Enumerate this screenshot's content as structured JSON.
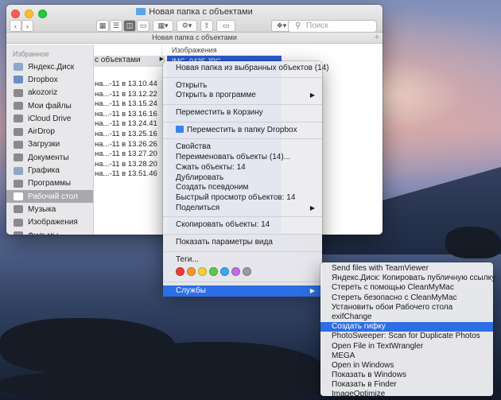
{
  "window": {
    "title": "Новая папка с объектами",
    "pathbar_title": "Новая папка с объектами",
    "search_placeholder": "Поиск"
  },
  "sidebar": {
    "section": "Избранное",
    "items": [
      {
        "label": "Яндекс.Диск",
        "icon": "folder-icon"
      },
      {
        "label": "Dropbox",
        "icon": "dropbox-icon"
      },
      {
        "label": "akozoriz",
        "icon": "home-icon"
      },
      {
        "label": "Мои файлы",
        "icon": "files-icon"
      },
      {
        "label": "iCloud Drive",
        "icon": "cloud-icon"
      },
      {
        "label": "AirDrop",
        "icon": "airdrop-icon"
      },
      {
        "label": "Загрузки",
        "icon": "downloads-icon"
      },
      {
        "label": "Документы",
        "icon": "documents-icon"
      },
      {
        "label": "Графика",
        "icon": "folder-icon"
      },
      {
        "label": "Программы",
        "icon": "applications-icon"
      },
      {
        "label": "Рабочий стол",
        "icon": "desktop-icon"
      },
      {
        "label": "Музыка",
        "icon": "music-icon"
      },
      {
        "label": "Изображения",
        "icon": "images-icon"
      },
      {
        "label": "Фильмы",
        "icon": "movies-icon"
      }
    ],
    "selected_index": 10
  },
  "content": {
    "column_header": "Изображения",
    "first_row": "с объектами",
    "selected_first": "IMG_0435.JPG",
    "dates": [
      "на...-11 в 13.10.44",
      "на...-11 в 13.12.22",
      "на...-11 в 13.15.24",
      "на...-11 в 13.16.16",
      "на...-11 в 13.24.41",
      "на...-11 в 13.25.16",
      "на...-11 в 13.26.26",
      "на...-11 в 13.27.20",
      "на...-11 в 13.28.20",
      "на...-11 в 13.51.46"
    ]
  },
  "context_menu": {
    "new_folder": "Новая папка из выбранных объектов (14)",
    "open": "Открыть",
    "open_with": "Открыть в программе",
    "trash": "Переместить в Корзину",
    "dropbox": "Переместить в папку Dropbox",
    "properties": "Свойства",
    "rename": "Переименовать объекты (14)...",
    "compress": "Сжать объекты: 14",
    "duplicate": "Дублировать",
    "alias": "Создать псевдоним",
    "quicklook": "Быстрый просмотр объектов: 14",
    "share": "Поделиться",
    "copy": "Скопировать объекты: 14",
    "view_options": "Показать параметры вида",
    "tags": "Теги...",
    "services": "Службы",
    "tag_colors": [
      "#f0393a",
      "#f7962a",
      "#f6cf35",
      "#5cc848",
      "#3aa5f2",
      "#c46ce3",
      "#9a9a9f"
    ]
  },
  "services_menu": {
    "items": [
      "Send files with TeamViewer",
      "Яндекс.Диск: Копировать публичную ссылку",
      "Стереть с помощью CleanMyMac",
      "Стереть безопасно с CleanMyMac",
      "Установить обои Рабочего стола",
      "exifChange",
      "Создать гифку",
      "PhotoSweeper: Scan for Duplicate Photos",
      "Open File in TextWrangler",
      "MEGA",
      "Open in Windows",
      "Показать в Windows",
      "Показать в Finder",
      "ImageOptimize"
    ],
    "highlighted_index": 6
  }
}
